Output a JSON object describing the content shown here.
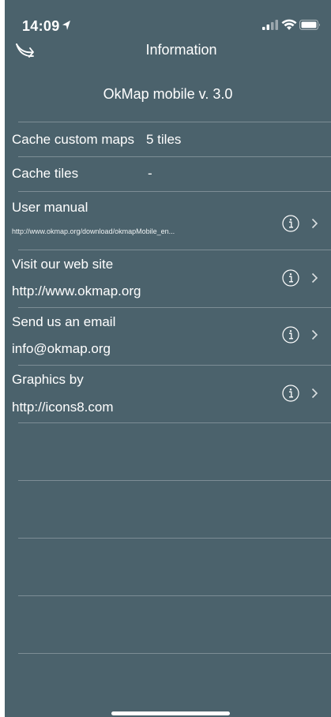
{
  "status_bar": {
    "time": "14:09",
    "icons": [
      "location-arrow-icon",
      "cellular-signal-icon",
      "wifi-icon",
      "battery-icon"
    ]
  },
  "nav": {
    "title": "Information",
    "back_icon": "curved-arrow-back-icon"
  },
  "app_version": "OkMap mobile v. 3.0",
  "rows": [
    {
      "label": "Cache custom maps",
      "value": "5 tiles"
    },
    {
      "label": "Cache tiles",
      "value": "-"
    },
    {
      "label": "User manual",
      "value": "http://www.okmap.org/download/okmapMobile_en...",
      "accessory": "info-chevron"
    },
    {
      "label": "Visit our web site",
      "value": "http://www.okmap.org",
      "accessory": "info-chevron"
    },
    {
      "label": "Send us an email",
      "value": "info@okmap.org",
      "accessory": "info-chevron"
    },
    {
      "label": "Graphics by",
      "value": "http://icons8.com",
      "accessory": "info-chevron"
    }
  ],
  "colors": {
    "background": "#4b626c",
    "text": "#ffffff",
    "separator": "rgba(255,255,255,0.28)"
  }
}
